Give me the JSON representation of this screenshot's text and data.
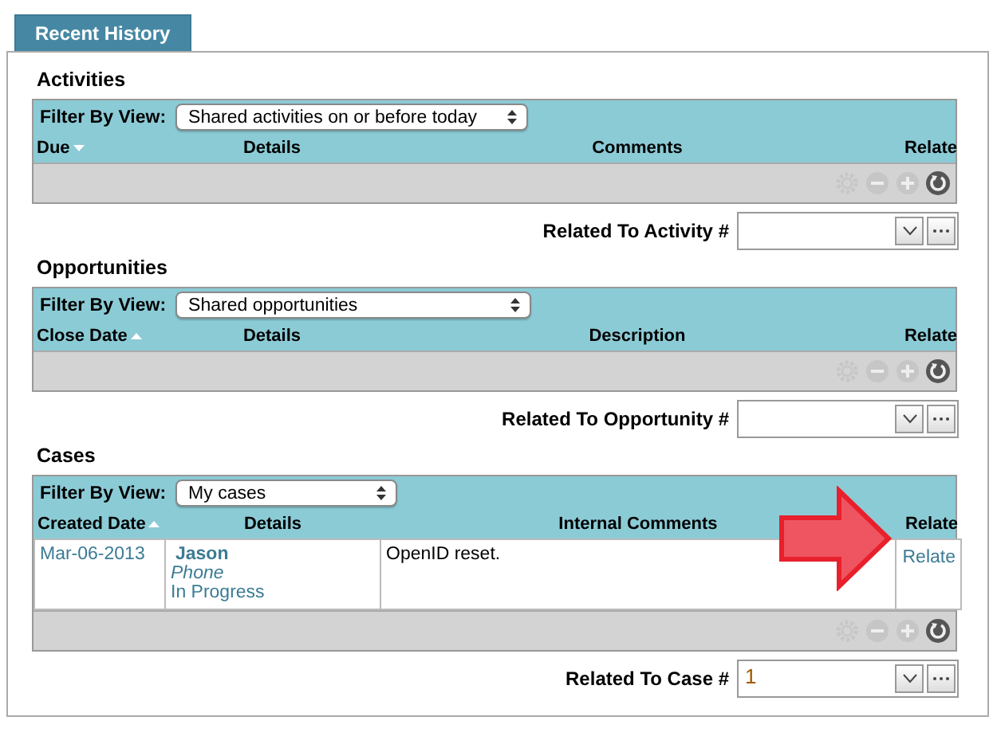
{
  "tab": {
    "label": "Recent History",
    "selected": true
  },
  "sections": [
    {
      "title": "Activities",
      "filter_label": "Filter By View:",
      "filter_value": "Shared activities on or before today",
      "columns": [
        {
          "label": "Due",
          "sort_ascending": false
        },
        {
          "label": "Details"
        },
        {
          "label": "Comments"
        },
        {
          "label": "Relate"
        }
      ],
      "tools": [
        {
          "kind": "settings",
          "disabled": true
        },
        {
          "kind": "remove",
          "disabled": true
        },
        {
          "kind": "add",
          "disabled": true
        },
        {
          "kind": "refresh",
          "disabled": false
        }
      ],
      "related_label": "Related To Activity #"
    },
    {
      "title": "Opportunities",
      "filter_label": "Filter By View:",
      "filter_value": "Shared opportunities",
      "columns": [
        {
          "label": "Close Date",
          "sort_ascending": true
        },
        {
          "label": "Details"
        },
        {
          "label": "Description"
        },
        {
          "label": "Relate"
        }
      ],
      "tools": [
        {
          "kind": "settings",
          "disabled": true
        },
        {
          "kind": "remove",
          "disabled": true
        },
        {
          "kind": "add",
          "disabled": true
        },
        {
          "kind": "refresh",
          "disabled": false
        }
      ],
      "related_label": "Related To Opportunity #"
    },
    {
      "title": "Cases",
      "filter_label": "Filter By View:",
      "filter_value": "My cases",
      "columns": [
        {
          "label": "Created Date",
          "sort_ascending": true
        },
        {
          "label": "Details"
        },
        {
          "label": "Internal Comments"
        },
        {
          "label": "Relate"
        }
      ],
      "rows": [
        {
          "date": "Mar-06-2013",
          "name": "Jason",
          "type": "Phone",
          "status": "In Progress",
          "comments": "OpenID reset.",
          "action": "Relate"
        }
      ],
      "tools": [
        {
          "kind": "settings",
          "disabled": true
        },
        {
          "kind": "remove",
          "disabled": true
        },
        {
          "kind": "add",
          "disabled": true
        },
        {
          "kind": "refresh",
          "disabled": false
        }
      ],
      "related_label": "Related To Case #",
      "related_value": "1"
    }
  ],
  "callout": {
    "kind": "arrow"
  }
}
